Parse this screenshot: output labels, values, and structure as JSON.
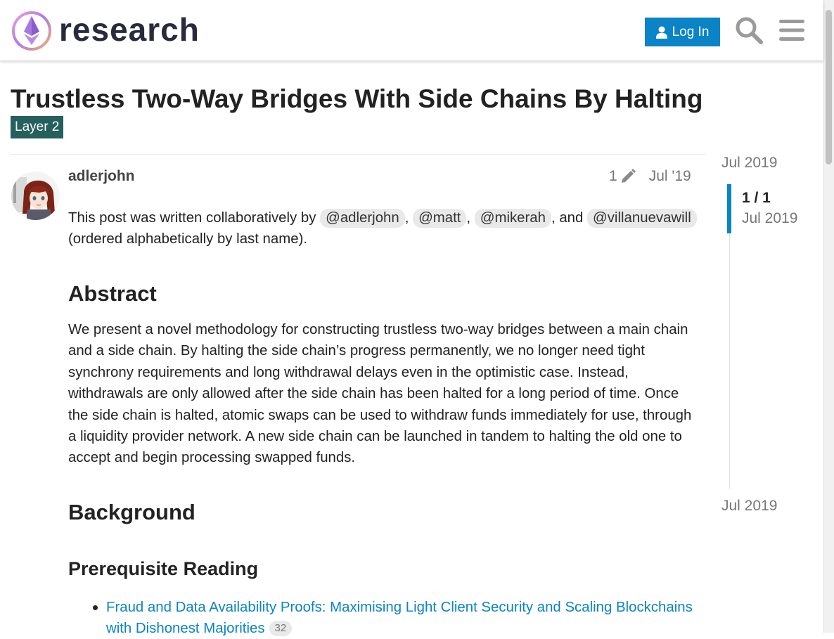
{
  "header": {
    "site_name": "research",
    "login_label": "Log In",
    "search_icon": "search-icon",
    "menu_icon": "hamburger-menu-icon",
    "accent": "#0a83c7"
  },
  "topic": {
    "title": "Trustless Two-Way Bridges With Side Chains By Halting",
    "category": "Layer 2",
    "category_color": "#25605e"
  },
  "post": {
    "username": "adlerjohn",
    "edit_count": "1",
    "date": "Jul '19",
    "intro_prefix": "This post was written collaboratively by",
    "mentions": [
      "@adlerjohn",
      "@matt",
      "@mikerah",
      "@villanuevawill"
    ],
    "sep_comma": ",",
    "sep_and": ", and",
    "intro_suffix": "(ordered alphabetically by last name).",
    "abstract_heading": "Abstract",
    "abstract_text": "We present a novel methodology for constructing trustless two-way bridges between a main chain and a side chain. By halting the side chain’s progress permanently, we no longer need tight synchrony requirements and long withdrawal delays even in the optimistic case. Instead, withdrawals are only allowed after the side chain has been halted for a long period of time. Once the side chain is halted, atomic swaps can be used to withdraw funds immediately for use, through a liquidity provider network. A new side chain can be launched in tandem to halting the old one to accept and begin processing swapped funds.",
    "background_heading": "Background",
    "prereq_heading": "Prerequisite Reading",
    "reading": [
      {
        "title": "Fraud and Data Availability Proofs: Maximising Light Client Security and Scaling Blockchains with Dishonest Majorities",
        "count": "32"
      }
    ]
  },
  "timeline": {
    "start_date": "Jul 2019",
    "position": "1 / 1",
    "position_date": "Jul 2019",
    "end_date": "Jul 2019"
  }
}
